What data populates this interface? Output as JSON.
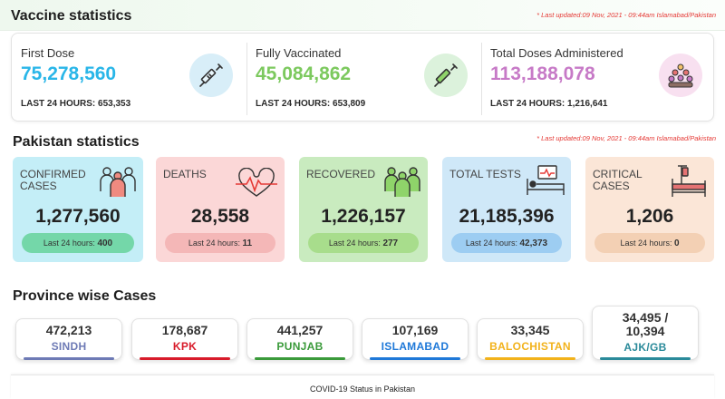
{
  "vaccine": {
    "title": "Vaccine statistics",
    "updated": "* Last updated:09 Nov, 2021 - 09:44am Islamabad/Pakistan",
    "items": [
      {
        "label": "First Dose",
        "value": "75,278,560",
        "last24": "LAST 24 HOURS: 653,353",
        "color": "#29b6e8",
        "icon": "syringe-icon"
      },
      {
        "label": "Fully Vaccinated",
        "value": "45,084,862",
        "last24": "LAST 24 HOURS: 653,809",
        "color": "#7cc95e",
        "icon": "syringe-icon"
      },
      {
        "label": "Total Doses Administered",
        "value": "113,188,078",
        "last24": "LAST 24 HOURS: 1,216,641",
        "color": "#c77ac7",
        "icon": "crowd-icon"
      }
    ]
  },
  "pakistan": {
    "title": "Pakistan statistics",
    "updated": "* Last updated:09 Nov, 2021 - 09:44am Islamabad/Pakistan",
    "cards": [
      {
        "title": "CONFIRMED CASES",
        "value": "1,277,560",
        "pill_label": "Last 24 hours:",
        "pill_value": "400",
        "icon": "people-icon"
      },
      {
        "title": "DEATHS",
        "value": "28,558",
        "pill_label": "Last 24 hours:",
        "pill_value": "11",
        "icon": "heartbeat-icon"
      },
      {
        "title": "RECOVERED",
        "value": "1,226,157",
        "pill_label": "Last 24 hours:",
        "pill_value": "277",
        "icon": "people-icon"
      },
      {
        "title": "TOTAL TESTS",
        "value": "21,185,396",
        "pill_label": "Last 24 hours:",
        "pill_value": "42,373",
        "icon": "hospital-bed-icon"
      },
      {
        "title": "CRITICAL CASES",
        "value": "1,206",
        "pill_label": "Last 24 hours:",
        "pill_value": "0",
        "icon": "iv-bed-icon"
      }
    ]
  },
  "province": {
    "title": "Province wise Cases",
    "items": [
      {
        "value": "472,213",
        "name": "SINDH",
        "color": "#6d7ab5"
      },
      {
        "value": "178,687",
        "name": "KPK",
        "color": "#d81b2a"
      },
      {
        "value": "441,257",
        "name": "PUNJAB",
        "color": "#3a9a3a"
      },
      {
        "value": "107,169",
        "name": "ISLAMABAD",
        "color": "#1e78d8"
      },
      {
        "value": "33,345",
        "name": "BALOCHISTAN",
        "color": "#f2b21b"
      },
      {
        "value": "34,495 / 10,394",
        "value_line1": "34,495 /",
        "value_line2": "10,394",
        "name": "AJK/GB",
        "color": "#2a8a9a"
      }
    ]
  },
  "footer": {
    "text": "COVID-19 Status in Pakistan"
  }
}
